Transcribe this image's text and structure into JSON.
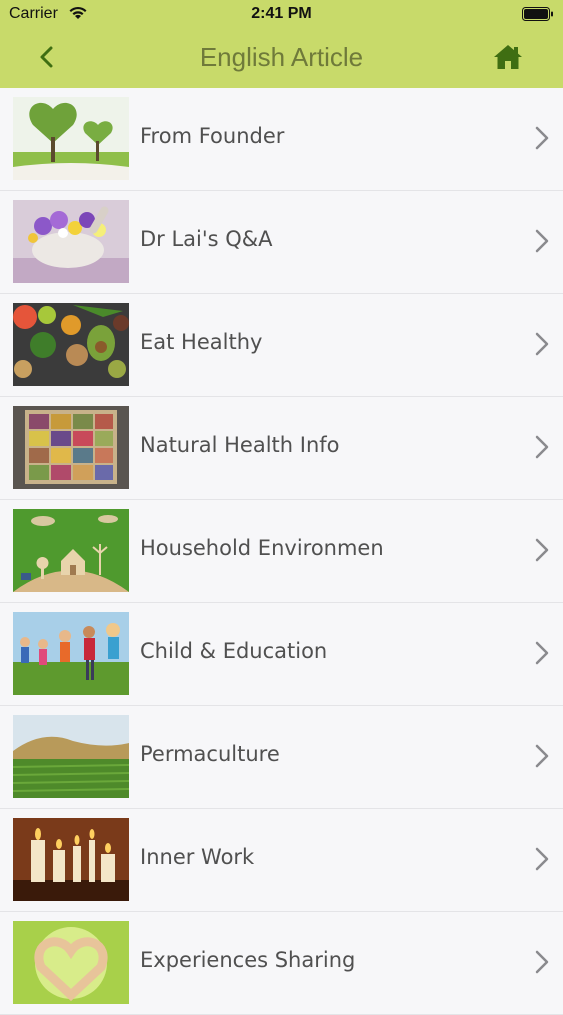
{
  "status_bar": {
    "carrier": "Carrier",
    "time": "2:41 PM"
  },
  "nav": {
    "title": "English Article",
    "back_icon": "chevron-left-icon",
    "home_icon": "home-icon"
  },
  "colors": {
    "header_bg": "#c8da6a",
    "title_color": "#6f7a3a",
    "icon_color": "#3f6e12"
  },
  "articles": [
    {
      "label": "From Founder"
    },
    {
      "label": "Dr Lai's Q&A"
    },
    {
      "label": "Eat Healthy"
    },
    {
      "label": "Natural Health Info"
    },
    {
      "label": "Household Environmen"
    },
    {
      "label": "Child & Education"
    },
    {
      "label": "Permaculture"
    },
    {
      "label": "Inner Work"
    },
    {
      "label": "Experiences Sharing"
    }
  ]
}
